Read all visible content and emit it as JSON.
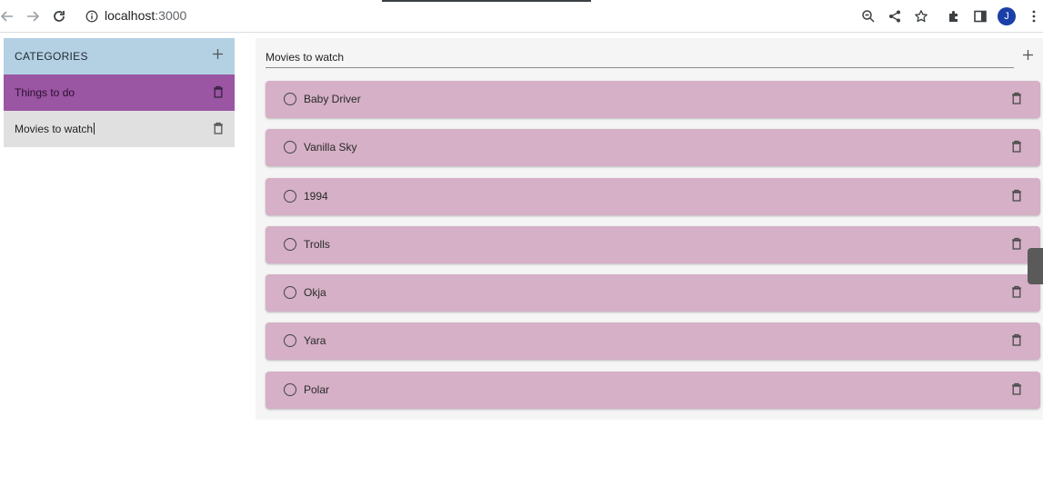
{
  "browser": {
    "url_host": "localhost",
    "url_port": ":3000",
    "profile_initial": "J"
  },
  "sidebar": {
    "header": "CATEGORIES",
    "categories": [
      {
        "label": "Things to do",
        "active": true
      },
      {
        "label": "Movies to watch",
        "active": false
      }
    ]
  },
  "main": {
    "category_name": "Movies to watch",
    "items": [
      {
        "label": "Baby Driver"
      },
      {
        "label": "Vanilla Sky"
      },
      {
        "label": "1994"
      },
      {
        "label": "Trolls"
      },
      {
        "label": "Okja"
      },
      {
        "label": "Yara"
      },
      {
        "label": "Polar"
      }
    ]
  },
  "colors": {
    "sidebar_header": "#b4d0e3",
    "active_category": "#9a55a3",
    "item_card": "#d5b0c6"
  }
}
